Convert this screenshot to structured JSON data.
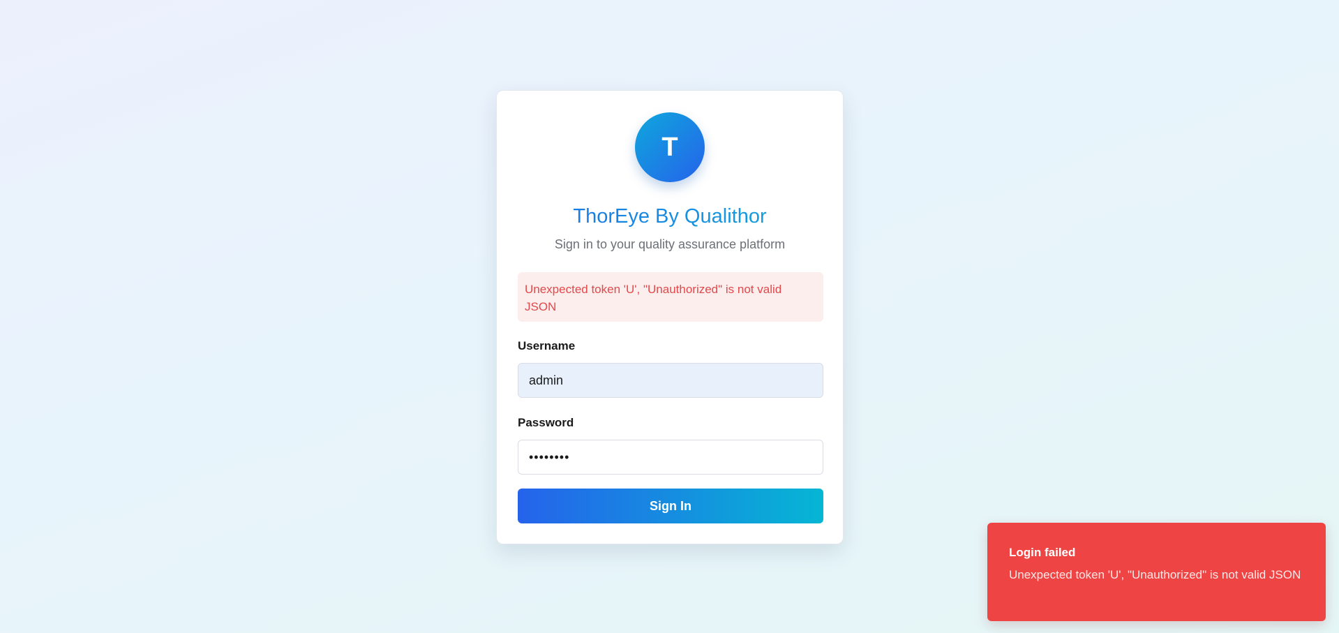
{
  "app": {
    "logo_letter": "T",
    "title": "ThorEye By Qualithor",
    "subtitle": "Sign in to your quality assurance platform"
  },
  "alert": {
    "message": "Unexpected token 'U', \"Unauthorized\" is not valid JSON"
  },
  "form": {
    "username_label": "Username",
    "username_value": "admin",
    "password_label": "Password",
    "password_value": "password",
    "submit_label": "Sign In"
  },
  "toast": {
    "title": "Login failed",
    "message": "Unexpected token 'U', \"Unauthorized\" is not valid JSON"
  },
  "colors": {
    "accent_start": "#2563eb",
    "accent_end": "#06b6d4",
    "error": "#ef4444"
  }
}
